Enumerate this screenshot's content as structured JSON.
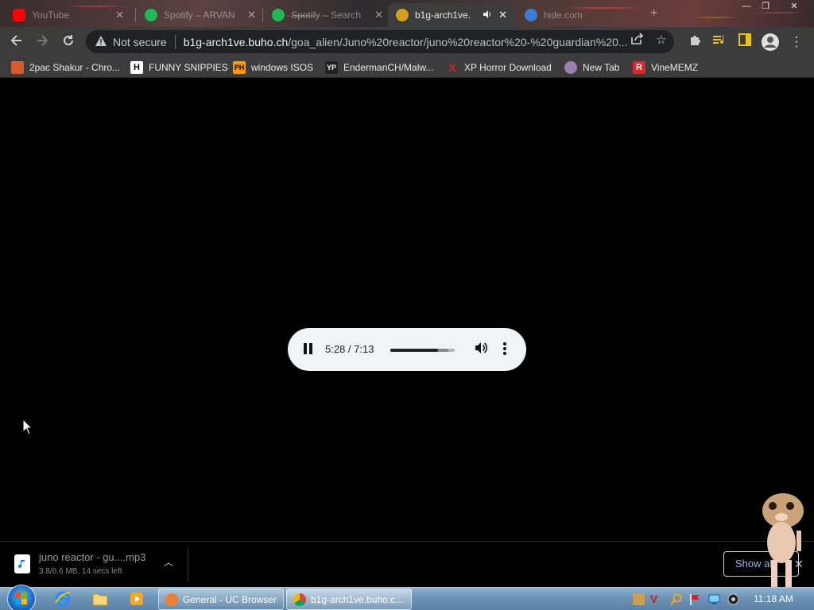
{
  "tabs": [
    {
      "title": "YouTube",
      "close": "✕",
      "color": "#ff0000"
    },
    {
      "title": "Spotify – ARVAN",
      "close": "✕",
      "color": "#1db954"
    },
    {
      "title": "Spotify – Search",
      "close": "✕",
      "color": "#1db954"
    },
    {
      "title": "b1g-arch1ve.",
      "close": "✕",
      "color": "#d4a020",
      "active": true
    },
    {
      "title": "hide.com",
      "close": "✕",
      "color": "#3a7bd5"
    }
  ],
  "new_tab_symbol": "+",
  "omnibox": {
    "security_label": "Not secure",
    "host": "b1g-arch1ve.buho.ch",
    "path": "/goa_alien/Juno%20reactor/juno%20reactor%20-%20guardian%20..."
  },
  "bookmarks": [
    {
      "label": "2pac Shakur - Chro...",
      "icon": "📰",
      "color": "#d85b2a"
    },
    {
      "label": "FUNNY SNIPPIES",
      "icon": "H",
      "color": "#ffffff"
    },
    {
      "label": "windows ISOS",
      "icon": "PH",
      "color": "#ff9900"
    },
    {
      "label": "EndermanCH/Malw...",
      "icon": "YP",
      "color": "#222222"
    },
    {
      "label": "XP Horror Download",
      "icon": "X",
      "color": "#cc0000"
    },
    {
      "label": "New Tab",
      "icon": "◉",
      "color": "#9a7fb0"
    },
    {
      "label": "VineMEMZ",
      "icon": "R",
      "color": "#d42a2a"
    }
  ],
  "player": {
    "time": "5:28 / 7:13",
    "progress": 0.74,
    "buffered": 0.9
  },
  "download": {
    "filename": "juno reactor - gu....mp3",
    "status": "3.8/6.6 MB, 14 secs left",
    "show_all": "Show all"
  },
  "taskbar": {
    "windows": [
      {
        "label": "General - UC Browser",
        "color": "#f08030"
      },
      {
        "label": "b1g-arch1ve.buho.c...",
        "color": "#4caf50",
        "active": true
      }
    ],
    "clock": "11:18 AM"
  }
}
